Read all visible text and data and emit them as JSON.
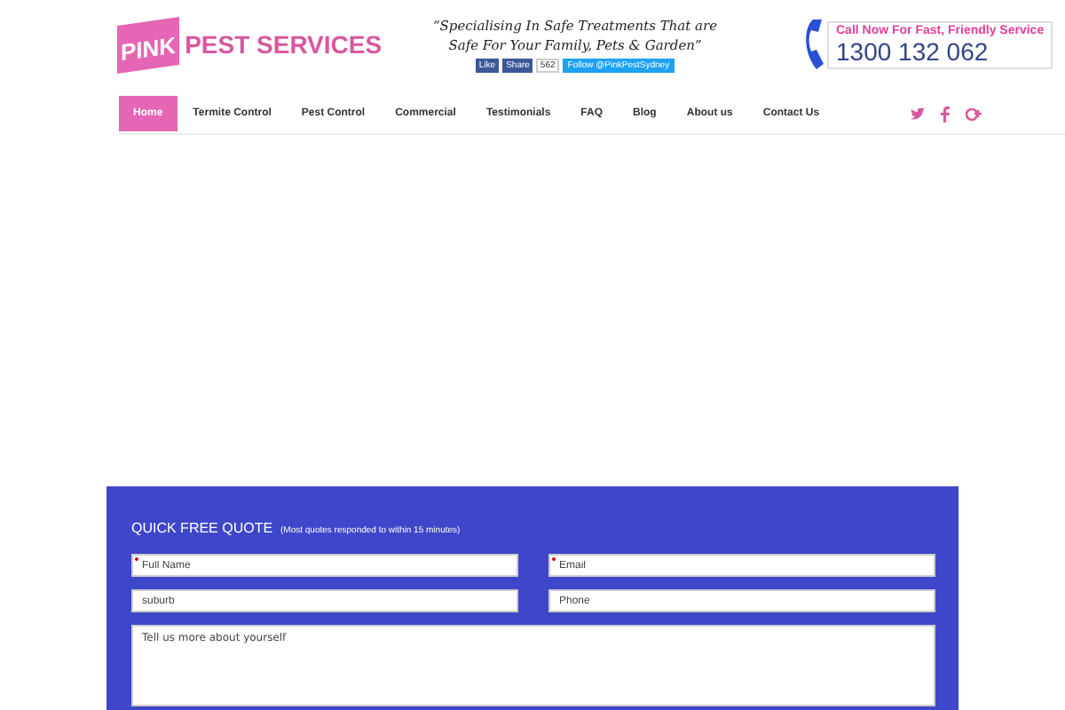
{
  "logo": {
    "highlight": "PINK",
    "text": "PEST SERVICES"
  },
  "tagline": [
    "“Specialising In Safe Treatments That are",
    "Safe For Your Family, Pets & Garden”"
  ],
  "social_buttons": {
    "like": "Like",
    "share": "Share",
    "count": "562",
    "follow": "Follow @PinkPestSydney"
  },
  "call": {
    "label": "Call Now For Fast, Friendly Service",
    "phone": "1300 132 062"
  },
  "nav": [
    {
      "label": "Home",
      "selected": true
    },
    {
      "label": "Termite Control",
      "selected": false
    },
    {
      "label": "Pest Control",
      "selected": false
    },
    {
      "label": "Commercial",
      "selected": false
    },
    {
      "label": "Testimonials",
      "selected": false
    },
    {
      "label": "FAQ",
      "selected": false
    },
    {
      "label": "Blog",
      "selected": false
    },
    {
      "label": "About us",
      "selected": false
    },
    {
      "label": "Contact Us",
      "selected": false
    }
  ],
  "social_icons": [
    {
      "kind": "twitter"
    },
    {
      "kind": "facebook"
    },
    {
      "kind": "google-plus"
    }
  ],
  "quote_form": {
    "title": "QUICK FREE QUOTE",
    "note": "(Most quotes responded to within 15 minutes)",
    "fields": [
      {
        "placeholder": "Full Name",
        "required": true
      },
      {
        "placeholder": "Email",
        "required": true
      },
      {
        "placeholder": "suburb",
        "required": false
      },
      {
        "placeholder": "Phone",
        "required": false
      }
    ],
    "message": {
      "placeholder": "Tell us more about yourself"
    }
  }
}
